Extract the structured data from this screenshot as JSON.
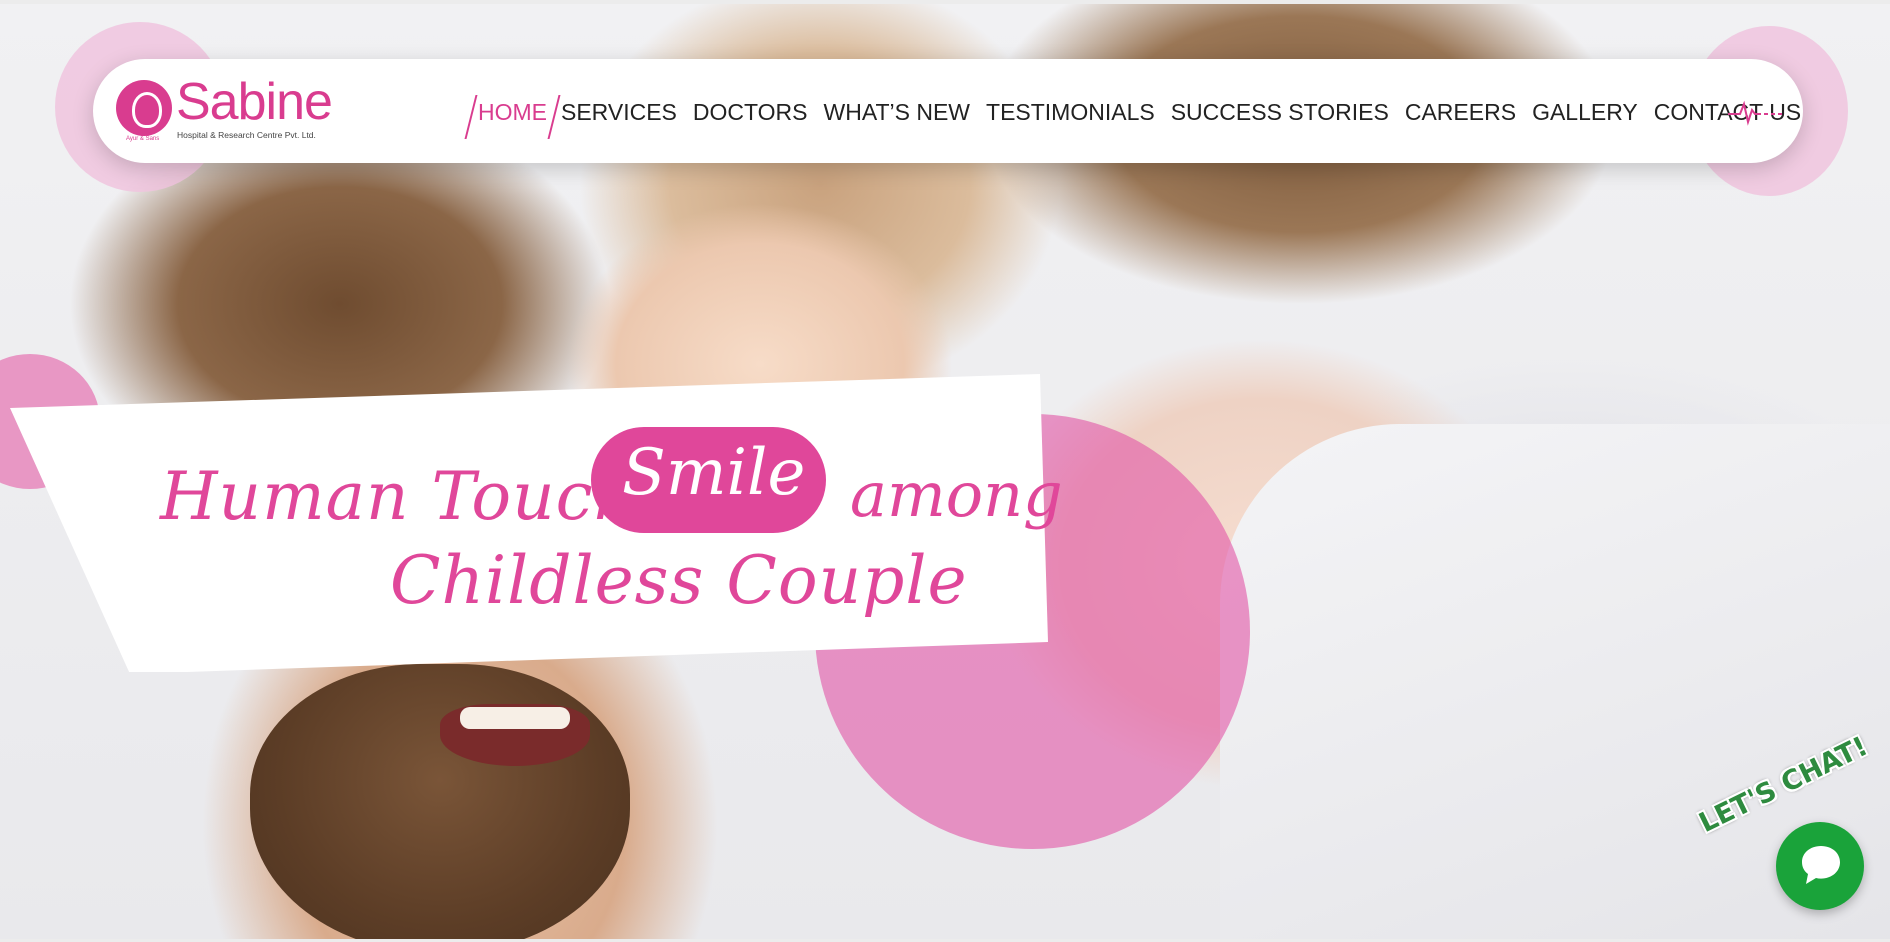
{
  "brand": {
    "name": "Sabine",
    "subtitle": "Hospital & Research Centre Pvt. Ltd.",
    "tagline": "Ayur & Sans",
    "color": "#d93c8f"
  },
  "nav": {
    "items": [
      {
        "label": "HOME",
        "active": true
      },
      {
        "label": "SERVICES",
        "active": false
      },
      {
        "label": "DOCTORS",
        "active": false
      },
      {
        "label": "WHAT’S NEW",
        "active": false
      },
      {
        "label": "TESTIMONIALS",
        "active": false
      },
      {
        "label": "SUCCESS STORIES",
        "active": false
      },
      {
        "label": "CAREERS",
        "active": false
      },
      {
        "label": "GALLERY",
        "active": false
      },
      {
        "label": "CONTACT US",
        "active": false
      }
    ],
    "icon": "heartbeat-icon"
  },
  "hero": {
    "line1": "Human Touch",
    "highlight": "Smile",
    "line1_end": "among",
    "line2": "Childless Couple",
    "accent_color": "#e0479a"
  },
  "chat": {
    "label": "LET'S CHAT!",
    "icon": "chat-bubble-icon",
    "color": "#1aa33a"
  }
}
